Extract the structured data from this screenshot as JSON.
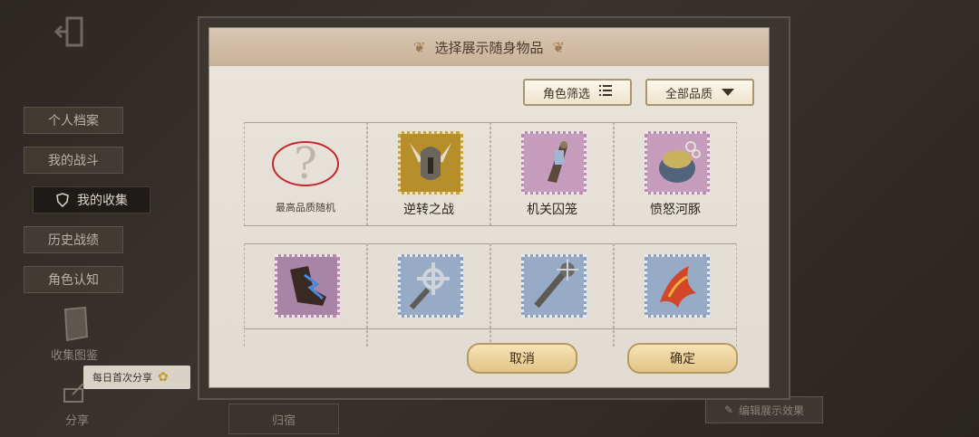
{
  "sidebar": {
    "items": [
      {
        "label": "个人档案"
      },
      {
        "label": "我的战斗"
      },
      {
        "label": "我的收集"
      },
      {
        "label": "历史战绩"
      },
      {
        "label": "角色认知"
      }
    ],
    "collection_label": "收集图鉴",
    "share_label": "分享",
    "share_tooltip": "每日首次分享"
  },
  "background": {
    "bottom_tab": "归宿",
    "edit_effect": "编辑展示效果"
  },
  "modal": {
    "title": "选择展示随身物品",
    "filter_role": "角色筛选",
    "filter_quality": "全部品质",
    "items": [
      {
        "label": "最高品质随机",
        "icon": "question-mark-icon"
      },
      {
        "label": "逆转之战",
        "icon": "winged-helmet-icon"
      },
      {
        "label": "机关囚笼",
        "icon": "cage-lantern-icon"
      },
      {
        "label": "愤怒河豚",
        "icon": "pufferfish-icon"
      },
      {
        "label": "",
        "icon": "lightning-boot-icon"
      },
      {
        "label": "",
        "icon": "cross-sword-icon"
      },
      {
        "label": "",
        "icon": "spiked-flail-icon"
      },
      {
        "label": "",
        "icon": "fire-feather-icon"
      }
    ],
    "cancel_label": "取消",
    "confirm_label": "确定"
  }
}
